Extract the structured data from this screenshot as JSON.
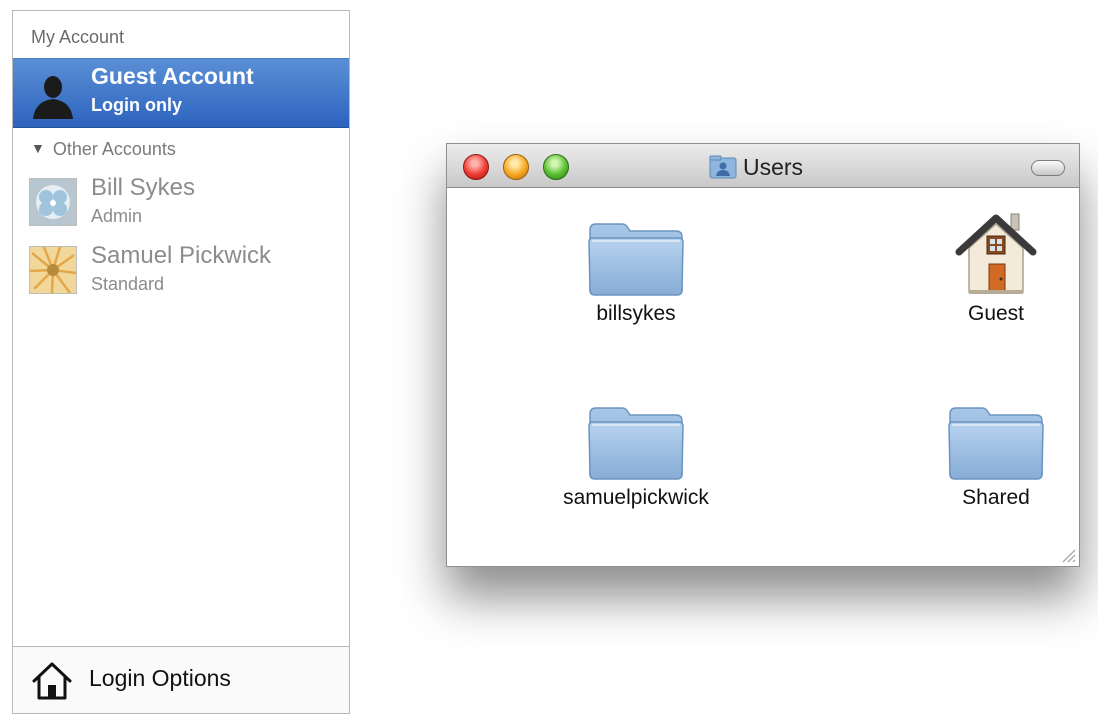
{
  "accounts_panel": {
    "header": "My Account",
    "selected_account": {
      "name": "Guest Account",
      "role": "Login only"
    },
    "group_label": "Other Accounts",
    "other_accounts": [
      {
        "name": "Bill Sykes",
        "role": "Admin"
      },
      {
        "name": "Samuel Pickwick",
        "role": "Standard"
      }
    ],
    "footer_label": "Login Options"
  },
  "finder_window": {
    "title": "Users",
    "items": [
      {
        "label": "billsykes",
        "icon": "folder-icon"
      },
      {
        "label": "Guest",
        "icon": "home-icon"
      },
      {
        "label": "samuelpickwick",
        "icon": "folder-icon"
      },
      {
        "label": "Shared",
        "icon": "folder-icon"
      }
    ]
  },
  "colors": {
    "selection_blue": "#2d63be",
    "close_red": "#ee3a31",
    "minimize_yellow": "#f6a621",
    "zoom_green": "#58bf2f",
    "folder_blue": "#8fb6de"
  }
}
